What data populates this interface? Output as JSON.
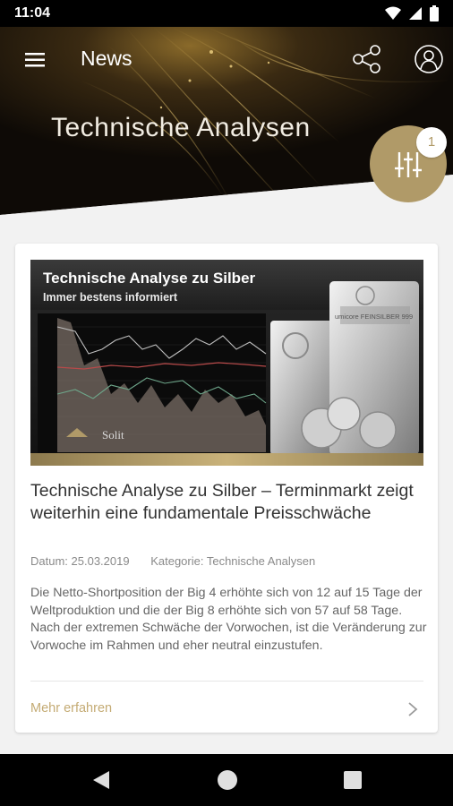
{
  "status_bar": {
    "time": "11:04"
  },
  "header": {
    "app_title": "News",
    "page_heading": "Technische Analysen",
    "filter_badge_count": "1"
  },
  "card": {
    "image": {
      "title": "Technische Analyse zu Silber",
      "subtitle": "Immer bestens informiert",
      "brand": "Solit",
      "bar_inscription": "umicore FEINSILBER 999"
    },
    "article_title": "Technische Analyse zu Silber – Terminmarkt zeigt weiterhin eine fundamentale Preisschwäche",
    "date": "Datum: 25.03.2019",
    "category": "Kategorie: Technische Analysen",
    "excerpt": "Die Netto-Shortposition der Big 4 erhöhte sich von 12 auf 15 Tage der Weltproduktion und die der Big 8 erhöhte sich von 57 auf 58 Tage. Nach der extremen Schwäche der Vorwochen, ist die Veränderung zur Vorwoche im Rahmen und eher neutral einzustufen.",
    "more_label": "Mehr erfahren"
  },
  "colors": {
    "accent_gold": "#b09a68",
    "link_gold": "#c4ab74",
    "header_dark": "#1a120a"
  }
}
